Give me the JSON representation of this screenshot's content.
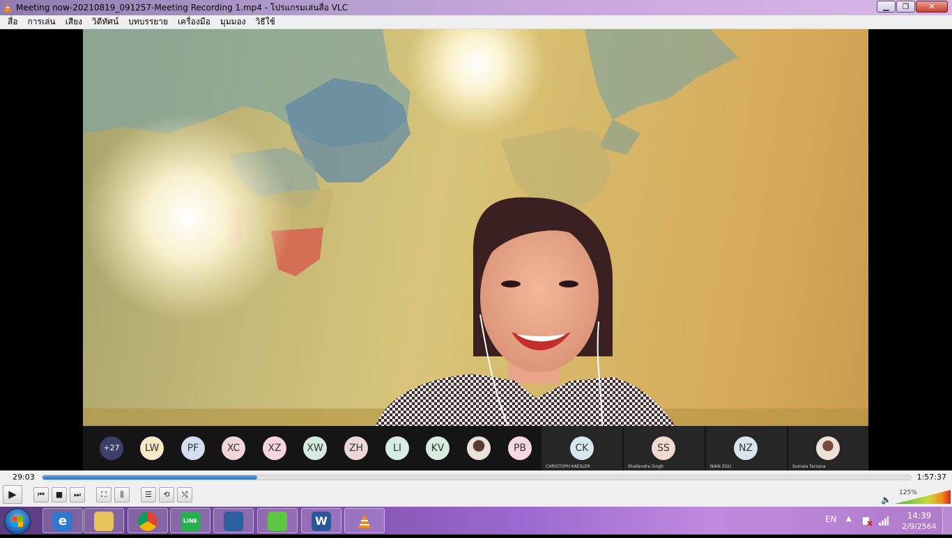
{
  "window": {
    "title": "Meeting now-20210819_091257-Meeting Recording 1.mp4 - โปรแกรมเล่นสื่อ VLC",
    "minimize_glyph": "▁",
    "maximize_glyph": "❐",
    "close_glyph": "✕"
  },
  "menu": {
    "items": [
      "สื่อ",
      "การเล่น",
      "เสียง",
      "วิดีทัศน์",
      "บทบรรยาย",
      "เครื่องมือ",
      "มุมมอง",
      "วิธีใช้"
    ]
  },
  "participants": {
    "overflow_count": "+27",
    "avatars": [
      {
        "initials": "LW",
        "color": "#f5e8c6"
      },
      {
        "initials": "PF",
        "color": "#d3dff0"
      },
      {
        "initials": "XC",
        "color": "#f0d6d6"
      },
      {
        "initials": "XZ",
        "color": "#f4d4dd"
      },
      {
        "initials": "XW",
        "color": "#d4ece0"
      },
      {
        "initials": "ZH",
        "color": "#ecd8d8"
      },
      {
        "initials": "LI",
        "color": "#d6ece4"
      },
      {
        "initials": "KV",
        "color": "#d6ecde"
      },
      {
        "initials": "",
        "color": "#e8e2da"
      },
      {
        "initials": "PB",
        "color": "#f6d8e0"
      }
    ],
    "tiles": [
      {
        "initials": "CK",
        "name": "CHRISTOPH KAESLER",
        "color": "#d6e8ec"
      },
      {
        "initials": "SS",
        "name": "Shailendra Singh",
        "color": "#f1d9cf"
      },
      {
        "initials": "NZ",
        "name": "NIAN ZOU",
        "color": "#d9e4ec"
      },
      {
        "initials": "",
        "name": "Sumaia Farzana",
        "color": "#eee2d8"
      }
    ]
  },
  "player": {
    "current_time": "29:03",
    "total_time": "1:57:37",
    "progress": 0.247,
    "volume_label": "125%",
    "volume_level": 1.0,
    "buttons": {
      "play": "▶",
      "prev": "⏮",
      "stop": "■",
      "next": "⏭",
      "fullscreen": "⛶",
      "extended": "⫼",
      "playlist": "☰",
      "loop": "⟲",
      "shuffle": "⤭",
      "volume_icon": "🔈"
    }
  },
  "taskbar": {
    "apps": [
      {
        "name": "internet-explorer",
        "label": "e",
        "color": "#2f7ad0"
      },
      {
        "name": "file-explorer",
        "label": "",
        "color": "#e8c25a"
      },
      {
        "name": "chrome",
        "label": "",
        "color": "#ffffff"
      },
      {
        "name": "line",
        "label": "LINE",
        "color": "#22b14c"
      },
      {
        "name": "document-app",
        "label": "",
        "color": "#2d5fa0"
      },
      {
        "name": "wechat",
        "label": "",
        "color": "#5ec642"
      },
      {
        "name": "word",
        "label": "W",
        "color": "#2b579a"
      },
      {
        "name": "vlc",
        "label": "",
        "color": "#f08a1c"
      }
    ],
    "language": "EN",
    "time": "14:39",
    "date": "2/9/2564"
  }
}
